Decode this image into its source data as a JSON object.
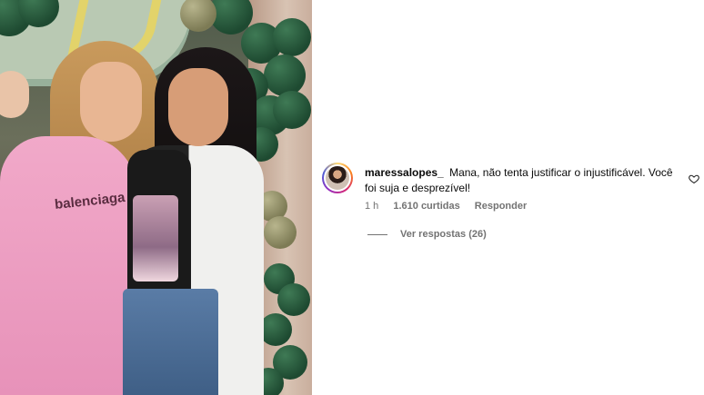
{
  "photo": {
    "shirt_print": "balenciaga"
  },
  "comment": {
    "username": "maressalopes_",
    "text": "Mana, não tenta justificar o injustificável. Você foi suja e desprezível!",
    "time": "1 h",
    "likes": "1.610 curtidas",
    "reply_label": "Responder",
    "view_replies": "Ver respostas (26)"
  },
  "colors": {
    "meta_text": "#737373",
    "primary_text": "#0a0a0a",
    "background": "#ffffff"
  },
  "icons": {
    "like": "heart-outline-icon"
  }
}
